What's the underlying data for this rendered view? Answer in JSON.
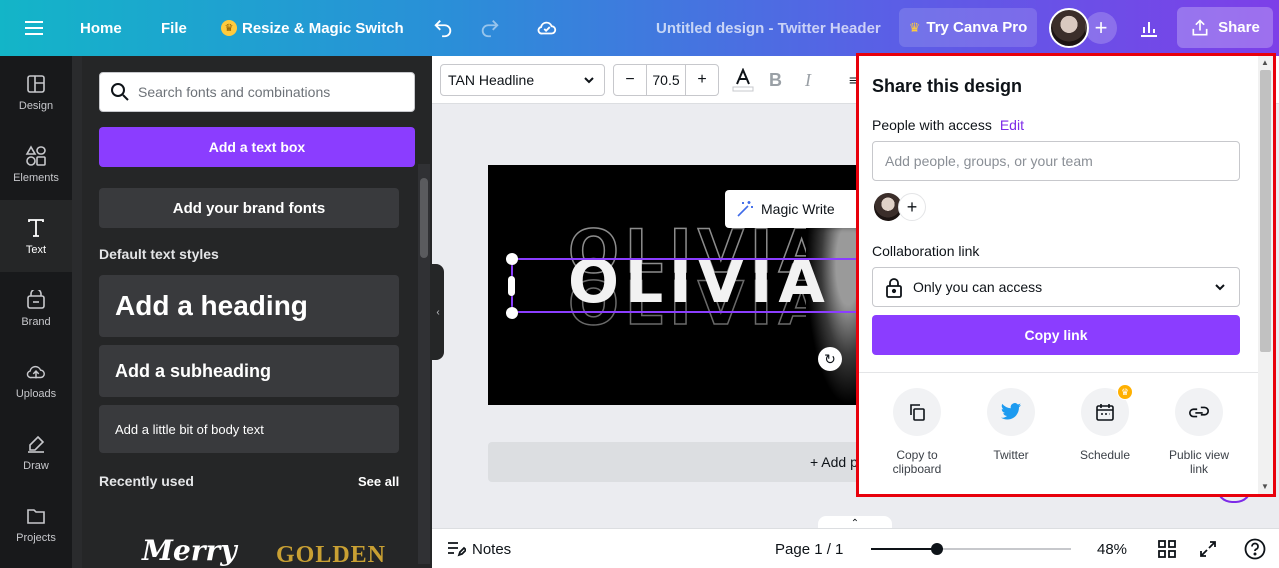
{
  "topbar": {
    "home": "Home",
    "file": "File",
    "resize": "Resize & Magic Switch",
    "design_title": "Untitled design - Twitter Header",
    "try_pro": "Try Canva Pro",
    "share": "Share"
  },
  "rail": {
    "items": [
      {
        "label": "Design",
        "icon": "layout-icon"
      },
      {
        "label": "Elements",
        "icon": "shapes-icon"
      },
      {
        "label": "Text",
        "icon": "text-icon"
      },
      {
        "label": "Brand",
        "icon": "brand-icon"
      },
      {
        "label": "Uploads",
        "icon": "upload-cloud-icon"
      },
      {
        "label": "Draw",
        "icon": "draw-icon"
      },
      {
        "label": "Projects",
        "icon": "folder-icon"
      }
    ],
    "active": "Text"
  },
  "panel": {
    "search_placeholder": "Search fonts and combinations",
    "add_text_box": "Add a text box",
    "add_brand_fonts": "Add your brand fonts",
    "default_styles_label": "Default text styles",
    "heading": "Add a heading",
    "subheading": "Add a subheading",
    "body": "Add a little bit of body text",
    "recently_used": "Recently used",
    "see_all": "See all",
    "font_preview_1": "Merry",
    "font_preview_2": "GOLDEN"
  },
  "toolbar": {
    "font_name": "TAN Headline",
    "font_size": "70.5",
    "minus": "−",
    "plus": "+"
  },
  "canvas": {
    "headline": "OLIVIA",
    "magic_write": "Magic Write",
    "add_page": "+ Add page"
  },
  "bottombar": {
    "notes": "Notes",
    "page": "Page 1 / 1",
    "zoom": "48%",
    "zoom_value": 48
  },
  "share_panel": {
    "title": "Share this design",
    "people_with_access": "People with access",
    "edit": "Edit",
    "add_people_placeholder": "Add people, groups, or your team",
    "collaboration_link": "Collaboration link",
    "access_option": "Only you can access",
    "copy_link": "Copy link",
    "actions": [
      {
        "label": "Copy to clipboard",
        "icon": "copy-icon"
      },
      {
        "label": "Twitter",
        "icon": "twitter-icon"
      },
      {
        "label": "Schedule",
        "icon": "calendar-icon"
      },
      {
        "label": "Public view link",
        "icon": "link-icon"
      }
    ]
  },
  "colors": {
    "accent": "#8b3dff",
    "edit_link": "#7d2ae8",
    "highlight_border": "#e8000b",
    "twitter": "#1d9bf0"
  }
}
